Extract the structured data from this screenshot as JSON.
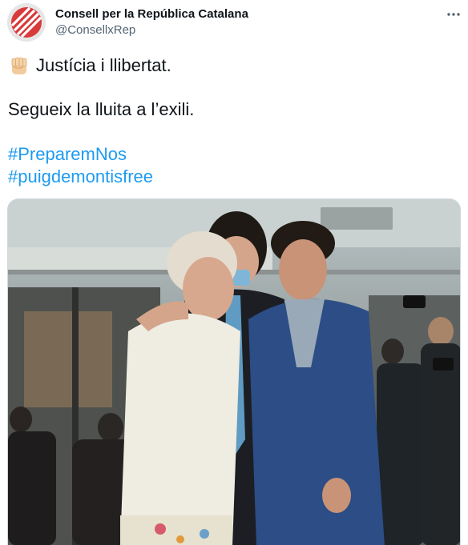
{
  "tweet": {
    "author_name": "Consell per la República Catalana",
    "author_handle": "@ConsellxRep",
    "text_line1": "Justícia i llibertat.",
    "text_line2": "Segueix la lluita a l’exili.",
    "hashtags": [
      "#PreparemNos",
      "#puigdemontisfree"
    ],
    "emoji_icon": "raised-fist-icon",
    "more_icon": "more-options-icon"
  },
  "colors": {
    "link": "#1d9bf0",
    "text": "#0f1419",
    "secondary": "#536471",
    "brand": "#d93a3a"
  }
}
